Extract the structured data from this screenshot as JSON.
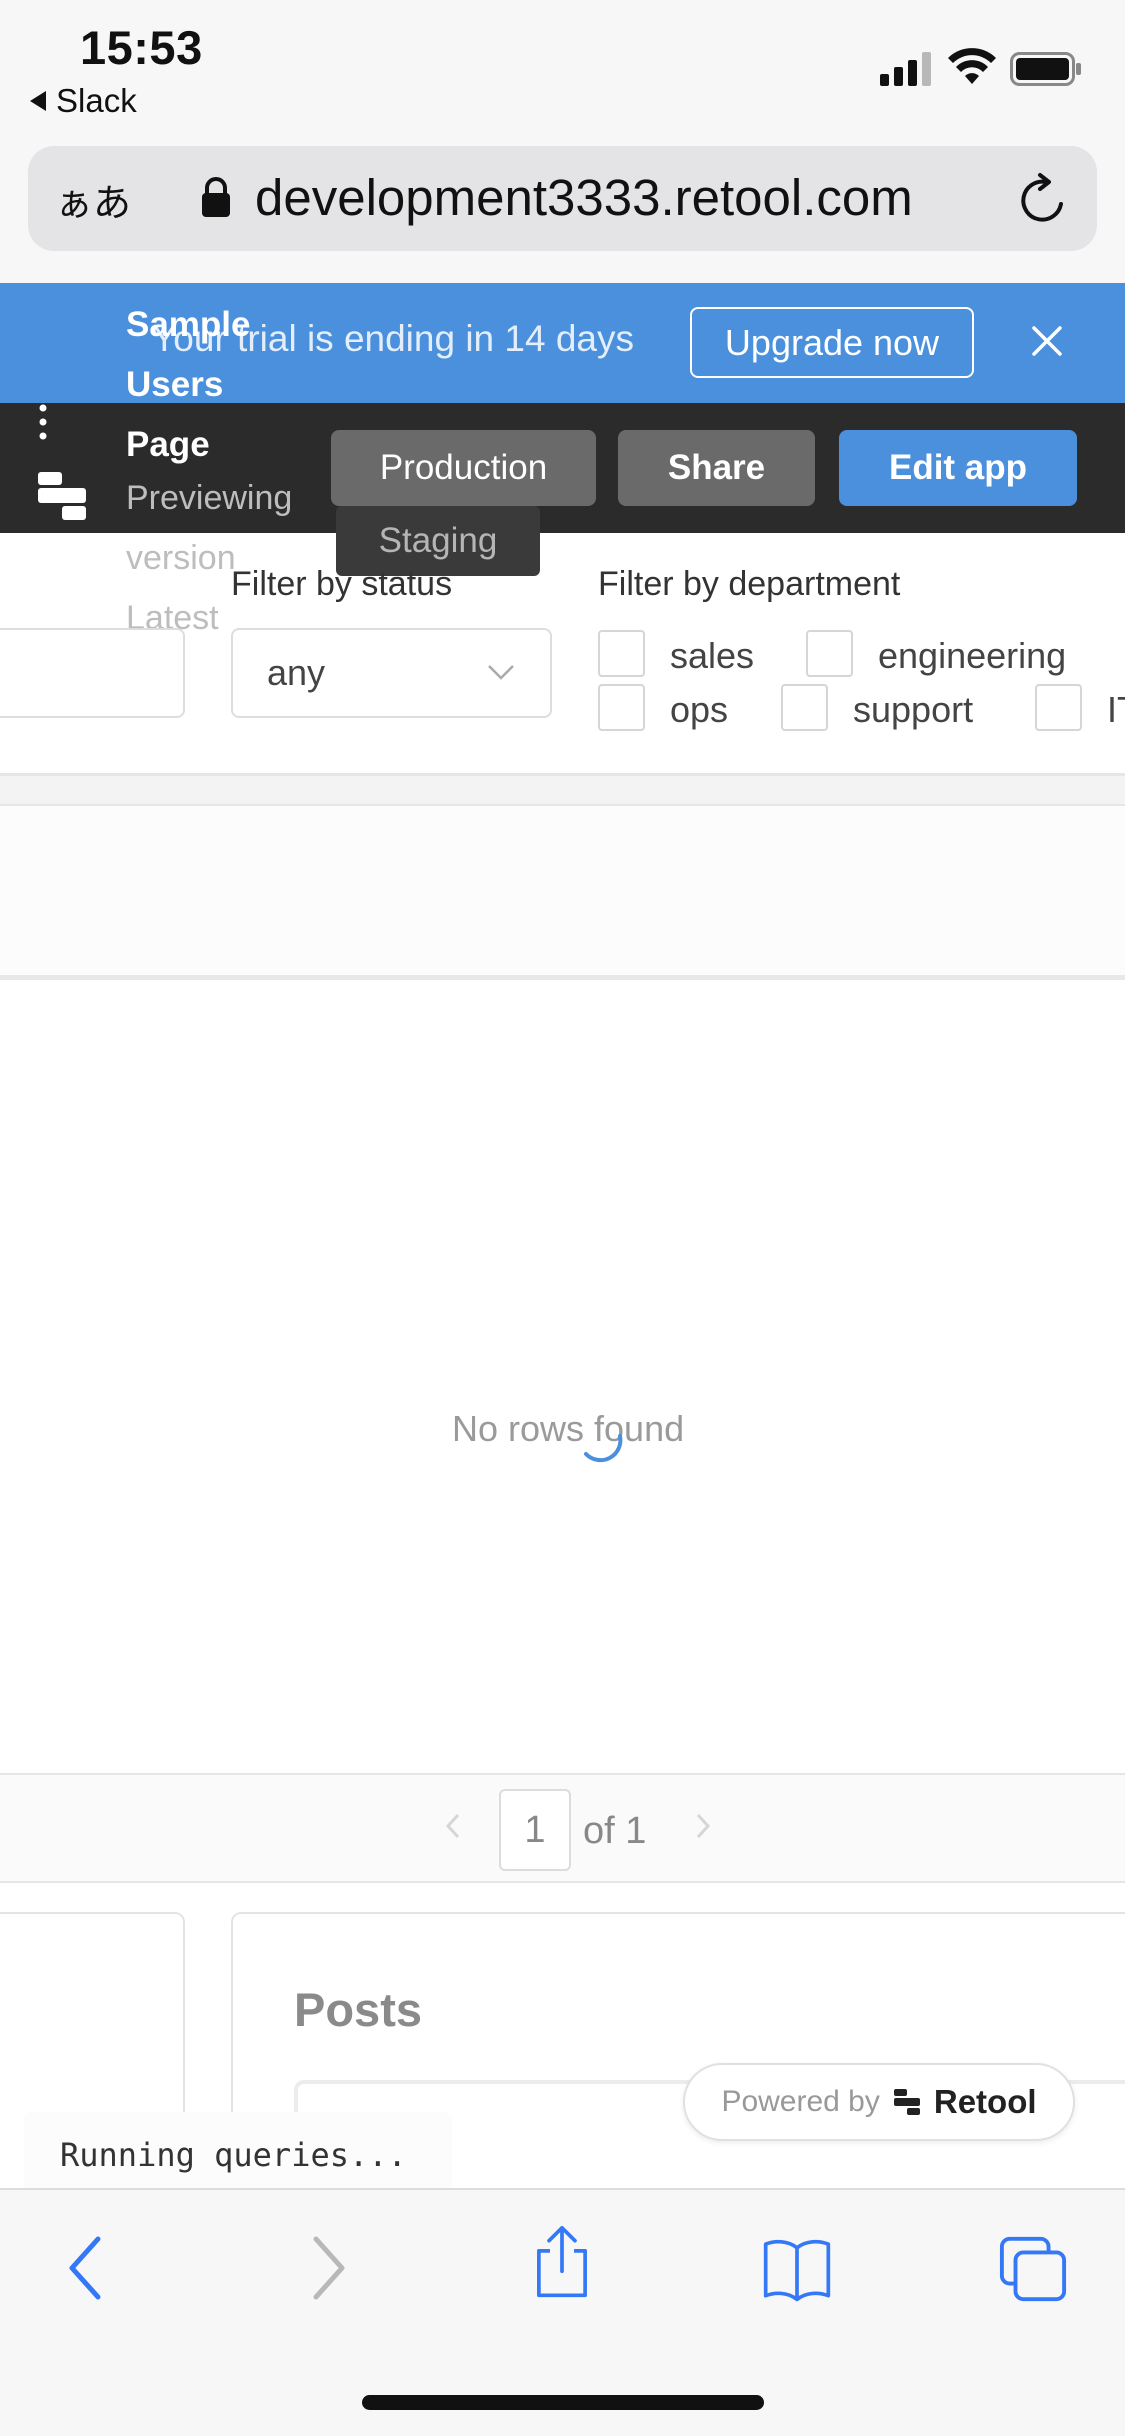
{
  "status_bar": {
    "time": "15:53",
    "back_app": "Slack"
  },
  "browser": {
    "text_size_button": "ぁあ",
    "url": "development3333.retool.com"
  },
  "trial_banner": {
    "text": "Your trial is ending in 14 days",
    "upgrade_label": "Upgrade now"
  },
  "header": {
    "app_name": "Sample\nUsers\nPage",
    "preview_text": "Previewing\nversion\nLatest",
    "env_production": "Production",
    "env_staging": "Staging",
    "share_label": "Share",
    "edit_label": "Edit app"
  },
  "filters": {
    "status_label": "Filter by status",
    "status_value": "any",
    "department_label": "Filter by department",
    "departments": [
      "sales",
      "engineering",
      "ops",
      "support",
      "IT"
    ]
  },
  "table": {
    "empty_text": "No rows found"
  },
  "pagination": {
    "page": "1",
    "of_text": "of 1"
  },
  "posts": {
    "title": "Posts"
  },
  "status": {
    "running": "Running queries..."
  },
  "powered_by": {
    "label": "Powered by",
    "brand": "Retool"
  },
  "colors": {
    "accent": "#4a90dd",
    "header_bg": "#2b2b2b",
    "ios_blue": "#3478f6"
  }
}
